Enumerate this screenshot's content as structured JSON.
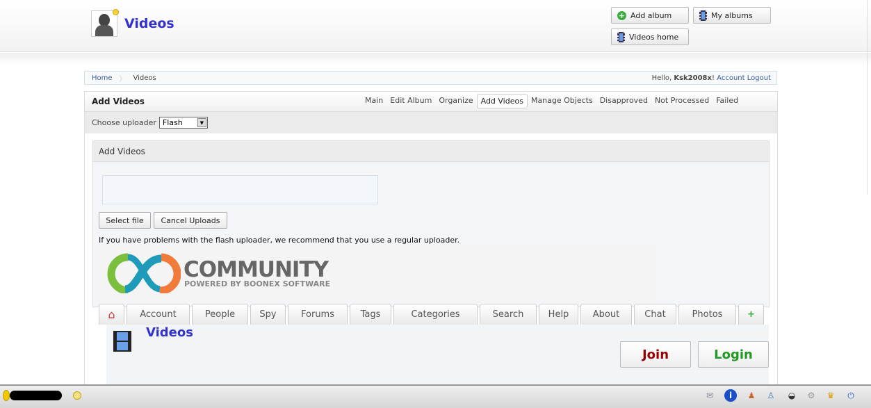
{
  "header": {
    "title": "Videos",
    "buttons": {
      "add_album": "Add album",
      "my_albums": "My albums",
      "videos_home": "Videos home"
    }
  },
  "breadcrumb": {
    "items": [
      "Home",
      "Videos"
    ],
    "greeting": "Hello, ",
    "username": "Ksk2008x",
    "exclaim": "!",
    "account": "Account",
    "logout": "Logout"
  },
  "box": {
    "title": "Add Videos",
    "menu": [
      "Main",
      "Edit Album",
      "Organize",
      "Add Videos",
      "Manage Objects",
      "Disapproved",
      "Not Processed",
      "Failed"
    ],
    "active_menu": "Add Videos",
    "uploader_label": "Choose uploader",
    "uploader_value": "Flash"
  },
  "inner": {
    "title": "Add Videos",
    "select_file": "Select file",
    "cancel_uploads": "Cancel Uploads",
    "notice": "If you have problems with the flash uploader, we recommend that you use a regular uploader."
  },
  "logo": {
    "name": "COMMUNITY",
    "tagline": "POWERED BY BOONEX SOFTWARE"
  },
  "nav": {
    "tabs": [
      "Account",
      "People",
      "Spy",
      "Forums",
      "Tags",
      "Categories",
      "Search",
      "Help",
      "About",
      "Chat",
      "Photos"
    ]
  },
  "lower": {
    "title": "Videos",
    "join": "Join",
    "login": "Login"
  },
  "colors": {
    "title": "#3333cc",
    "join": "#990000",
    "login": "#229922"
  }
}
